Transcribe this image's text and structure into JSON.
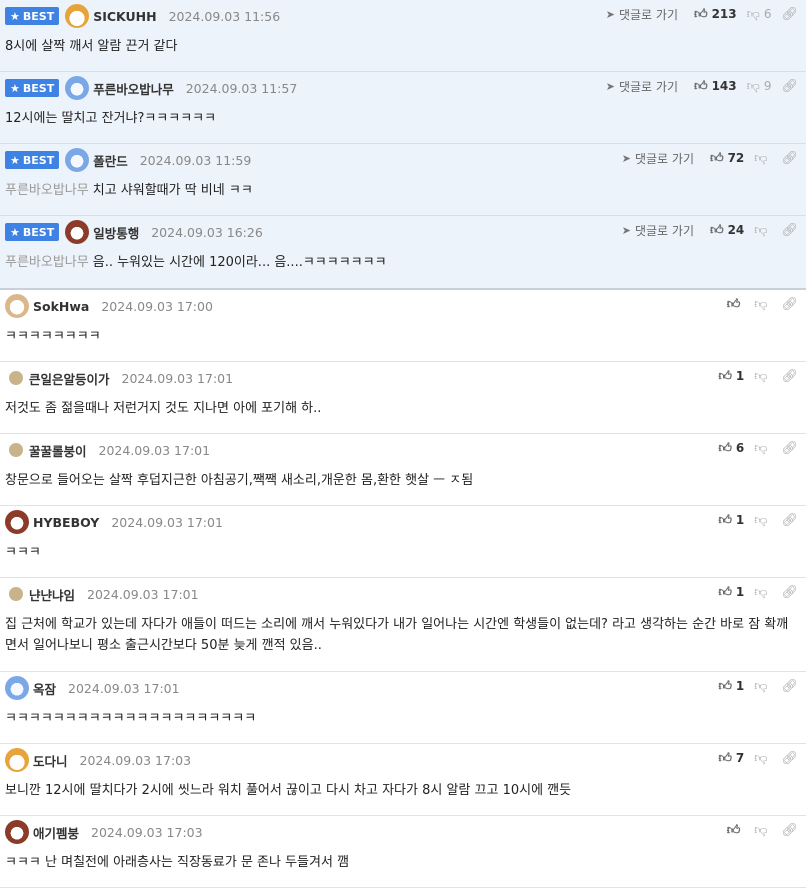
{
  "ui": {
    "best_label": "BEST",
    "reply_label": "댓글로 가기"
  },
  "comments": [
    {
      "best": true,
      "nickname": "SICKUHH",
      "date": "2024.09.03 11:56",
      "avatar": "fox",
      "reply": true,
      "likes": "213",
      "dislikes": "6",
      "mention": "",
      "text": "8시에 살짝 깨서 알람 끈거 같다"
    },
    {
      "best": true,
      "nickname": "푸른바오밥나무",
      "date": "2024.09.03 11:57",
      "avatar": "blue",
      "reply": true,
      "likes": "143",
      "dislikes": "9",
      "mention": "",
      "text": "12시에는 딸치고 잔거냐?ㅋㅋㅋㅋㅋㅋ"
    },
    {
      "best": true,
      "nickname": "폴란드",
      "date": "2024.09.03 11:59",
      "avatar": "blue",
      "reply": true,
      "likes": "72",
      "dislikes": "",
      "mention": "푸른바오밥나무",
      "text": "치고 샤워할때가 딱 비네 ㅋㅋ"
    },
    {
      "best": true,
      "nickname": "일방통행",
      "date": "2024.09.03 16:26",
      "avatar": "dog",
      "reply": true,
      "likes": "24",
      "dislikes": "",
      "mention": "푸른바오밥나무",
      "text": "음.. 누워있는 시간에 120이라... 음....ㅋㅋㅋㅋㅋㅋㅋ"
    },
    {
      "best": false,
      "nickname": "SokHwa",
      "date": "2024.09.03 17:00",
      "avatar": "cream",
      "reply": false,
      "likes": "",
      "dislikes": "",
      "mention": "",
      "text": "ㅋㅋㅋㅋㅋㅋㅋㅋ"
    },
    {
      "best": false,
      "nickname": "큰일은알등이가",
      "date": "2024.09.03 17:01",
      "avatar": "dot",
      "reply": false,
      "likes": "1",
      "dislikes": "",
      "mention": "",
      "text": "저것도 좀 젊을때나 저런거지 것도 지나면 아에 포기해 하.."
    },
    {
      "best": false,
      "nickname": "꿀꿀롤붕이",
      "date": "2024.09.03 17:01",
      "avatar": "dot",
      "reply": false,
      "likes": "6",
      "dislikes": "",
      "mention": "",
      "text": "창문으로 들어오는 살짝 후덥지근한 아침공기,짹짹 새소리,개운한 몸,환한 햇살 ㅡ ㅈ됨"
    },
    {
      "best": false,
      "nickname": "HYBEBOY",
      "date": "2024.09.03 17:01",
      "avatar": "dog",
      "reply": false,
      "likes": "1",
      "dislikes": "",
      "mention": "",
      "text": "ㅋㅋㅋ"
    },
    {
      "best": false,
      "nickname": "냔냔냐임",
      "date": "2024.09.03 17:01",
      "avatar": "dot",
      "reply": false,
      "likes": "1",
      "dislikes": "",
      "mention": "",
      "text": "집 근처에 학교가 있는데 자다가 애들이 떠드는 소리에 깨서 누워있다가 내가 일어나는 시간엔 학생들이 없는데? 라고 생각하는 순간 바로 잠 확깨면서 일어나보니 평소 출근시간보다 50분 늦게 깬적 있음.."
    },
    {
      "best": false,
      "nickname": "옥잠",
      "date": "2024.09.03 17:01",
      "avatar": "blue",
      "reply": false,
      "likes": "1",
      "dislikes": "",
      "mention": "",
      "text": "ㅋㅋㅋㅋㅋㅋㅋㅋㅋㅋㅋㅋㅋㅋㅋㅋㅋㅋㅋㅋㅋ"
    },
    {
      "best": false,
      "nickname": "도다니",
      "date": "2024.09.03 17:03",
      "avatar": "fox",
      "reply": false,
      "likes": "7",
      "dislikes": "",
      "mention": "",
      "text": "보니깐 12시에 딸치다가 2시에 씻느라 워치 풀어서 끊이고 다시 차고 자다가 8시 알람 끄고 10시에 깬듯"
    },
    {
      "best": false,
      "nickname": "애기펨붕",
      "date": "2024.09.03 17:03",
      "avatar": "dog",
      "reply": false,
      "likes": "",
      "dislikes": "",
      "mention": "",
      "text": "ㅋㅋㅋ 난 며칠전에 아래층사는 직장동료가 문 존나 두들겨서 깸"
    }
  ]
}
